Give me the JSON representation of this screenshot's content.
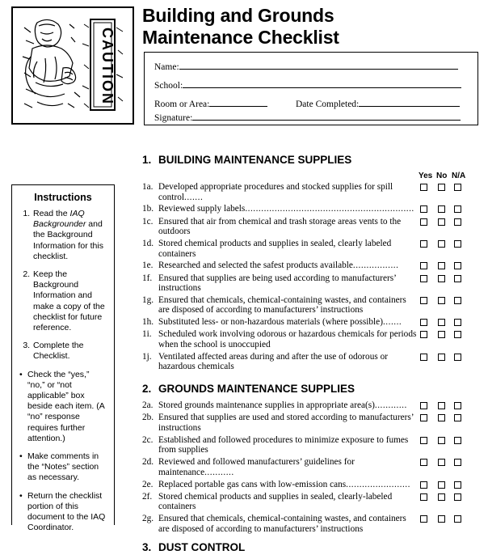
{
  "document": {
    "title_line1": "Building and Grounds",
    "title_line2": "Maintenance Checklist",
    "logo_caption": "CAUTION"
  },
  "form": {
    "name_label": "Name:",
    "school_label": "School:",
    "room_label": "Room or Area:",
    "date_label": "Date Completed:",
    "signature_label": "Signature:"
  },
  "instructions": {
    "heading": "Instructions",
    "numbered": [
      {
        "pre": "Read the ",
        "italic": "IAQ Backgrounder",
        "post": " and the Background Information for this checklist."
      },
      {
        "pre": "Keep the Background Information and make a copy of the checklist for future reference.",
        "italic": "",
        "post": ""
      },
      {
        "pre": "Complete the Checklist.",
        "italic": "",
        "post": ""
      }
    ],
    "bullets": [
      "Check the “yes,” “no,” or “not applicable” box beside each item. (A “no” response requires further attention.)",
      "Make comments in the “Notes” section as necessary.",
      "Return the checklist portion of this document to the IAQ Coordinator."
    ]
  },
  "columns": {
    "yes": "Yes",
    "no": "No",
    "na": "N/A"
  },
  "sections": [
    {
      "number": "1.",
      "title": "BUILDING MAINTENANCE SUPPLIES",
      "show_columns": true,
      "items": [
        {
          "label": "1a.",
          "text": "Developed appropriate procedures and stocked supplies for spill control",
          "leader": "......."
        },
        {
          "label": "1b.",
          "text": "Reviewed supply labels",
          "leader": "..............................................................."
        },
        {
          "label": "1c.",
          "text": "Ensured that air from chemical and trash storage areas vents to the outdoors",
          "leader": ""
        },
        {
          "label": "1d.",
          "text": "Stored chemical products and supplies in sealed, clearly labeled containers",
          "leader": ""
        },
        {
          "label": "1e.",
          "text": "Researched and selected the safest products available",
          "leader": "................."
        },
        {
          "label": "1f.",
          "text": "Ensured that supplies are being used according to manufacturers’ instructions",
          "leader": ""
        },
        {
          "label": "1g.",
          "text": "Ensured that chemicals, chemical-containing wastes, and containers are disposed of according to manufacturers’ instructions",
          "leader": ""
        },
        {
          "label": "1h.",
          "text": "Substituted less- or non-hazardous materials (where possible)",
          "leader": "......."
        },
        {
          "label": "1i.",
          "text": "Scheduled work involving odorous or hazardous chemicals for periods when the school is unoccupied",
          "leader": ""
        },
        {
          "label": "1j.",
          "text": "Ventilated affected areas during and after the use of odorous or hazardous chemicals",
          "leader": ""
        }
      ]
    },
    {
      "number": "2.",
      "title": "GROUNDS MAINTENANCE SUPPLIES",
      "show_columns": false,
      "items": [
        {
          "label": "2a.",
          "text": "Stored grounds maintenance supplies in appropriate area(s)",
          "leader": "............"
        },
        {
          "label": "2b.",
          "text": "Ensured that supplies are used and stored according to manufacturers’ instructions",
          "leader": ""
        },
        {
          "label": "2c.",
          "text": "Established and followed procedures to minimize exposure to fumes from supplies",
          "leader": ""
        },
        {
          "label": "2d.",
          "text": "Reviewed and followed manufacturers’ guidelines for maintenance",
          "leader": "..........."
        },
        {
          "label": "2e.",
          "text": "Replaced portable gas cans with low-emission cans",
          "leader": "........................"
        },
        {
          "label": "2f.",
          "text": "Stored chemical products and supplies in sealed, clearly-labeled containers",
          "leader": ""
        },
        {
          "label": "2g.",
          "text": "Ensured that chemicals, chemical-containing wastes, and containers are disposed of according to manufacturers’ instructions",
          "leader": ""
        }
      ]
    },
    {
      "number": "3.",
      "title": "DUST CONTROL",
      "show_columns": false,
      "items": []
    }
  ]
}
